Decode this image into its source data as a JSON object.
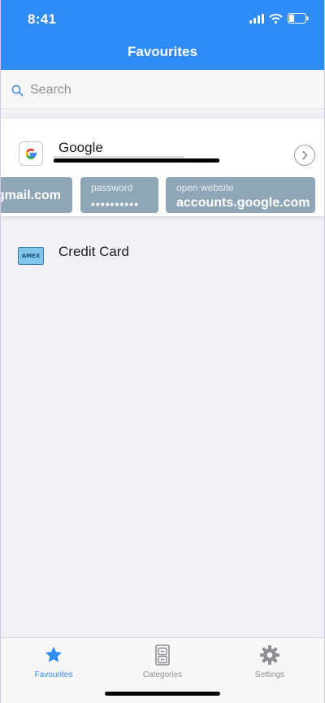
{
  "status_bar": {
    "time": "8:41"
  },
  "header": {
    "title": "Favourites"
  },
  "search": {
    "placeholder": "Search"
  },
  "items": [
    {
      "title": "Google",
      "icon": "google-g-icon",
      "fields": [
        {
          "label": "",
          "value": "gmail.com"
        },
        {
          "label": "password",
          "value": "••••••••••"
        },
        {
          "label": "open website",
          "value": "accounts.google.com"
        }
      ]
    },
    {
      "title": "Credit Card",
      "icon": "amex-card-icon",
      "icon_text": "AMEX"
    }
  ],
  "tabs": [
    {
      "label": "Favourites",
      "icon": "star-icon",
      "active": true
    },
    {
      "label": "Categories",
      "icon": "cabinet-icon",
      "active": false
    },
    {
      "label": "Settings",
      "icon": "gear-icon",
      "active": false
    }
  ],
  "colors": {
    "accent": "#2f8bf5",
    "pill": "#8fa6b7",
    "inactive": "#8e8e93"
  }
}
